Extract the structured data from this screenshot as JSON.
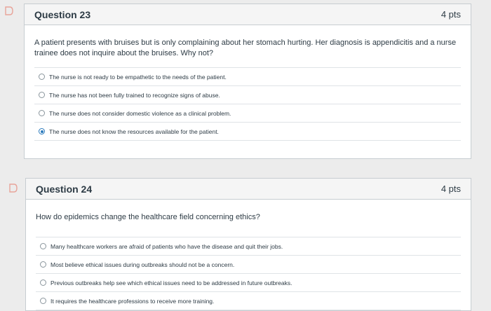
{
  "questions": [
    {
      "title": "Question 23",
      "points": "4 pts",
      "text": "A patient presents with bruises but is only complaining about her stomach hurting. Her diagnosis is appendicitis and a nurse trainee does not inquire about the bruises. Why not?",
      "answers": [
        {
          "label": "The nurse is not ready to be empathetic to the needs of the patient.",
          "selected": false
        },
        {
          "label": "The nurse has not been fully trained to recognize signs of abuse.",
          "selected": false
        },
        {
          "label": "The nurse does not consider domestic violence as a clinical problem.",
          "selected": false
        },
        {
          "label": "The nurse does not know the resources available for the patient.",
          "selected": true
        }
      ]
    },
    {
      "title": "Question 24",
      "points": "4 pts",
      "text": "How do epidemics change the healthcare field concerning ethics?",
      "answers": [
        {
          "label": "Many healthcare workers are afraid of patients who have the disease and quit their jobs.",
          "selected": false
        },
        {
          "label": "Most believe ethical issues during outbreaks should not be a concern.",
          "selected": false
        },
        {
          "label": "Previous outbreaks help see which ethical issues need to be addressed in future outbreaks.",
          "selected": false
        },
        {
          "label": "It requires the healthcare professions to receive more training.",
          "selected": false
        }
      ]
    }
  ],
  "icons": {
    "flag": "flag-icon"
  },
  "colors": {
    "accent": "#2b7abc",
    "flag": "#e8a49a"
  }
}
